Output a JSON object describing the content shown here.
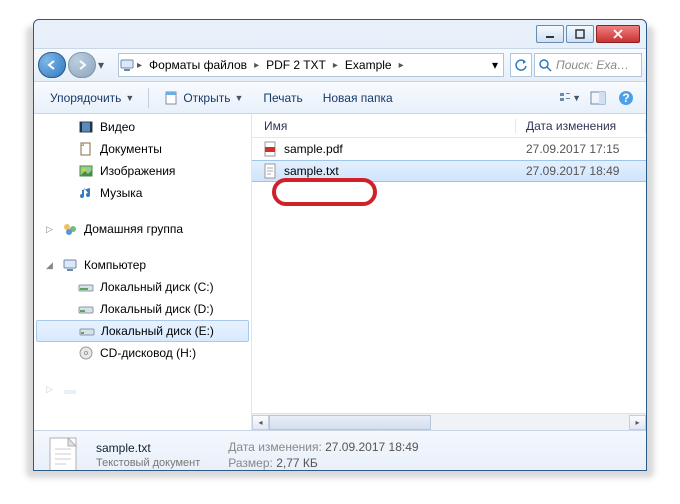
{
  "titlebar": {},
  "nav": {
    "breadcrumb": [
      "Форматы файлов",
      "PDF 2 TXT",
      "Example"
    ],
    "search_placeholder": "Поиск: Exa…"
  },
  "toolbar": {
    "organize": "Упорядочить",
    "open": "Открыть",
    "print": "Печать",
    "new_folder": "Новая папка"
  },
  "sidebar": {
    "libraries": [
      {
        "label": "Видео",
        "icon": "film"
      },
      {
        "label": "Документы",
        "icon": "doc"
      },
      {
        "label": "Изображения",
        "icon": "pic"
      },
      {
        "label": "Музыка",
        "icon": "music"
      }
    ],
    "homegroup": {
      "label": "Домашняя группа"
    },
    "computer": {
      "label": "Компьютер",
      "drives": [
        {
          "label": "Локальный диск (C:)"
        },
        {
          "label": "Локальный диск (D:)"
        },
        {
          "label": "Локальный диск (E:)",
          "selected": true
        },
        {
          "label": "CD-дисковод (H:)"
        }
      ]
    }
  },
  "columns": {
    "name": "Имя",
    "date": "Дата изменения"
  },
  "files": [
    {
      "name": "sample.pdf",
      "date": "27.09.2017 17:15",
      "icon": "pdf",
      "selected": false
    },
    {
      "name": "sample.txt",
      "date": "27.09.2017 18:49",
      "icon": "txt",
      "selected": true
    }
  ],
  "details": {
    "name": "sample.txt",
    "type": "Текстовый документ",
    "date_label": "Дата изменения:",
    "date": "27.09.2017 18:49",
    "size_label": "Размер:",
    "size": "2,77 КБ"
  }
}
